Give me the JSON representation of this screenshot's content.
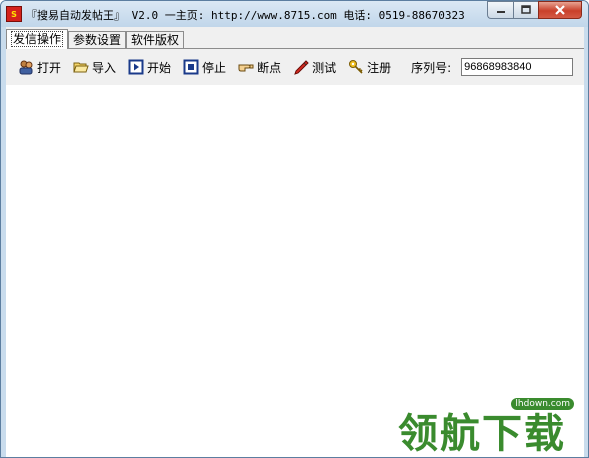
{
  "window": {
    "title": "『搜易自动发帖王』 V2.0  一主页: http://www.8715.com 电话: 0519-88670323",
    "icon_text": "S"
  },
  "tabs": [
    {
      "label": "发信操作",
      "active": true
    },
    {
      "label": "参数设置",
      "active": false
    },
    {
      "label": "软件版权",
      "active": false
    }
  ],
  "toolbar": {
    "items": [
      {
        "label": "打开",
        "icon": "open-people-icon"
      },
      {
        "label": "导入",
        "icon": "folder-open-icon"
      },
      {
        "label": "开始",
        "icon": "play-icon"
      },
      {
        "label": "停止",
        "icon": "stop-icon"
      },
      {
        "label": "断点",
        "icon": "hand-point-icon"
      },
      {
        "label": "测试",
        "icon": "pen-icon"
      },
      {
        "label": "注册",
        "icon": "key-icon"
      }
    ],
    "serial_label": "序列号:",
    "serial_value": "96868983840"
  },
  "watermark": {
    "text": "领航下载",
    "site": "lhdown.com"
  }
}
